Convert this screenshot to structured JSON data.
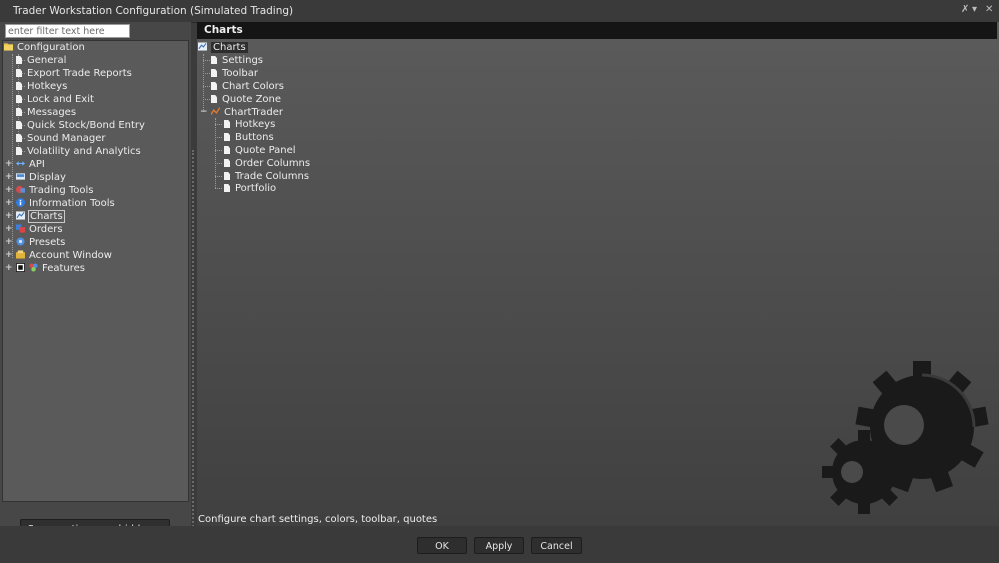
{
  "window": {
    "title": "Trader Workstation Configuration (Simulated Trading)",
    "controls": {
      "pin": "✗",
      "dropdown": "▾",
      "close": "✕"
    }
  },
  "filter": {
    "placeholder": "enter filter text here",
    "value": ""
  },
  "tree": {
    "root": "Configuration",
    "items": [
      {
        "label": "General",
        "icon": "document-icon"
      },
      {
        "label": "Export Trade Reports",
        "icon": "document-icon"
      },
      {
        "label": "Hotkeys",
        "icon": "document-icon"
      },
      {
        "label": "Lock and Exit",
        "icon": "document-icon"
      },
      {
        "label": "Messages",
        "icon": "document-icon"
      },
      {
        "label": "Quick Stock/Bond Entry",
        "icon": "document-icon"
      },
      {
        "label": "Sound Manager",
        "icon": "document-icon"
      },
      {
        "label": "Volatility and Analytics",
        "icon": "document-icon"
      }
    ],
    "groups": [
      {
        "label": "API",
        "icon": "api-arrows-icon"
      },
      {
        "label": "Display",
        "icon": "display-icon"
      },
      {
        "label": "Trading Tools",
        "icon": "trading-tools-icon"
      },
      {
        "label": "Information Tools",
        "icon": "info-icon"
      },
      {
        "label": "Charts",
        "icon": "chart-icon",
        "selected": true
      },
      {
        "label": "Orders",
        "icon": "orders-icon"
      },
      {
        "label": "Presets",
        "icon": "presets-icon"
      },
      {
        "label": "Account Window",
        "icon": "account-window-icon"
      },
      {
        "label": "Features",
        "icon": "features-icon"
      }
    ]
  },
  "hidden_button": "Some options are hidden...",
  "panel": {
    "header": "Charts",
    "root": "Charts",
    "items": [
      "Settings",
      "Toolbar",
      "Chart Colors",
      "Quote Zone"
    ],
    "subgroup": "ChartTrader",
    "subitems": [
      "Hotkeys",
      "Buttons",
      "Quote Panel",
      "Order Columns",
      "Trade Columns",
      "Portfolio"
    ],
    "description": "Configure chart settings, colors, toolbar, quotes"
  },
  "footer": {
    "ok": "OK",
    "apply": "Apply",
    "cancel": "Cancel"
  }
}
